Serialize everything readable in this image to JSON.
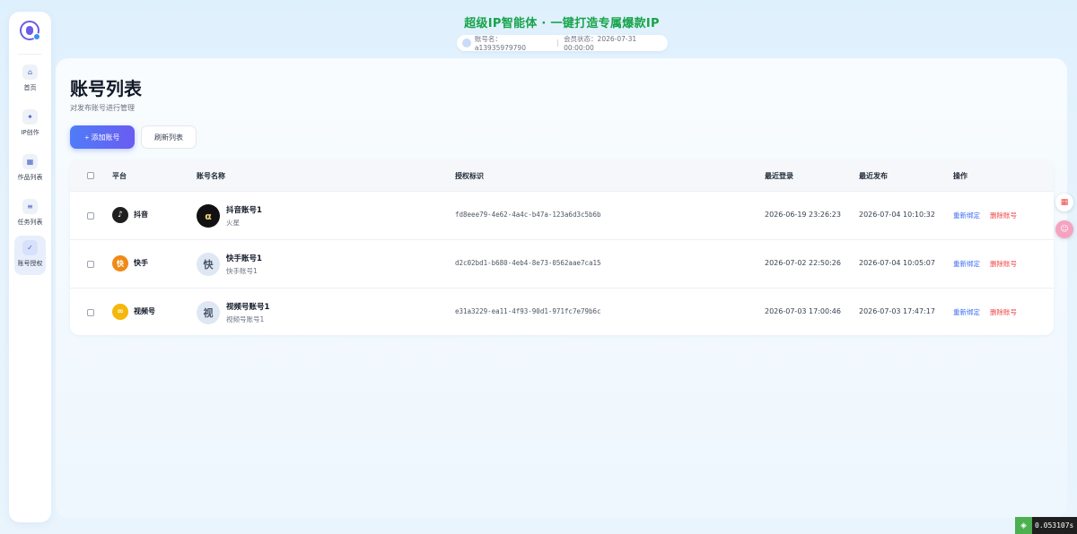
{
  "header": {
    "title": "超级IP智能体 · 一键打造专属爆款IP",
    "account_label": "账号名：a13935979790",
    "member_label": "会员状态：2026-07-31 00:00:00"
  },
  "sidebar": {
    "items": [
      {
        "label": "首页",
        "icon": "home-icon",
        "glyph": "⌂"
      },
      {
        "label": "IP创作",
        "icon": "sparkle-icon",
        "glyph": "✦"
      },
      {
        "label": "作品列表",
        "icon": "grid-icon",
        "glyph": "▦"
      },
      {
        "label": "任务列表",
        "icon": "list-icon",
        "glyph": "≡"
      },
      {
        "label": "账号授权",
        "icon": "check-icon",
        "glyph": "✓"
      }
    ],
    "active": 4
  },
  "page": {
    "title": "账号列表",
    "subtitle": "对发布账号进行管理",
    "add_button": "+ 添加账号",
    "refresh_button": "刷新列表"
  },
  "table": {
    "columns": [
      "平台",
      "账号名称",
      "授权标识",
      "最近登录",
      "最近发布",
      "操作"
    ],
    "rows": [
      {
        "platform": "抖音",
        "platform_icon": "douyin-icon",
        "platform_glyph": "♪",
        "platform_color": "#1f1f1f",
        "avatar_text": "α",
        "avatar_bg": "#111111",
        "avatar_fg": "#f2d27a",
        "name": "抖音账号1",
        "sub": "火星",
        "auth_id": "fd8eee79-4e62-4a4c-b47a-123a6d3c5b6b",
        "last_login": "2026-06-19 23:26:23",
        "last_publish": "2026-07-04 10:10:32",
        "action_rebind": "重新绑定",
        "action_delete": "删除账号"
      },
      {
        "platform": "快手",
        "platform_icon": "kuaishou-icon",
        "platform_glyph": "快",
        "platform_color": "#f08a17",
        "avatar_text": "快",
        "avatar_bg": "#dfe7f3",
        "avatar_fg": "#475569",
        "name": "快手账号1",
        "sub": "快手账号1",
        "auth_id": "d2c02bd1-b680-4eb4-8e73-0562aae7ca15",
        "last_login": "2026-07-02 22:50:26",
        "last_publish": "2026-07-04 10:05:07",
        "action_rebind": "重新绑定",
        "action_delete": "删除账号"
      },
      {
        "platform": "视频号",
        "platform_icon": "shipinhao-icon",
        "platform_glyph": "∞",
        "platform_color": "#f5b70b",
        "avatar_text": "视",
        "avatar_bg": "#dfe7f3",
        "avatar_fg": "#475569",
        "name": "视频号账号1",
        "sub": "视频号账号1",
        "auth_id": "e31a3229-ea11-4f93-90d1-971fc7e79b6c",
        "last_login": "2026-07-03 17:00:46",
        "last_publish": "2026-07-03 17:47:17",
        "action_rebind": "重新绑定",
        "action_delete": "删除账号"
      }
    ]
  },
  "floating": {
    "timer": "0.053107s"
  }
}
